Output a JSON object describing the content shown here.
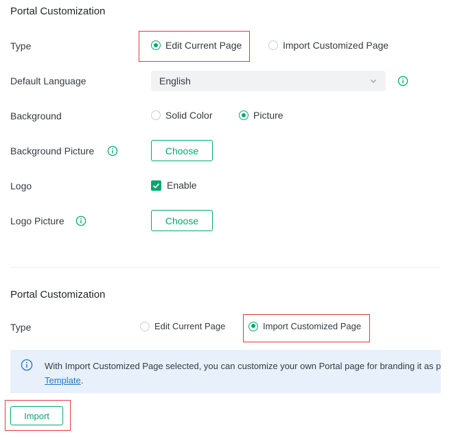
{
  "section1": {
    "title": "Portal Customization",
    "type_label": "Type",
    "type_options": [
      "Edit Current Page",
      "Import Customized Page"
    ],
    "default_language_label": "Default Language",
    "default_language_value": "English",
    "background_label": "Background",
    "background_options": [
      "Solid Color",
      "Picture"
    ],
    "background_picture_label": "Background Picture",
    "choose_label": "Choose",
    "logo_label": "Logo",
    "logo_enable_label": "Enable",
    "logo_picture_label": "Logo Picture",
    "logo_choose_label": "Choose"
  },
  "section2": {
    "title": "Portal Customization",
    "type_label": "Type",
    "type_options": [
      "Edit Current Page",
      "Import Customized Page"
    ],
    "banner_text": "With Import Customized Page selected, you can customize your own Portal page for branding it as pe",
    "banner_link": "Template",
    "banner_link_suffix": ".",
    "import_label": "Import"
  },
  "colors": {
    "accent": "#00a870",
    "highlight": "#e0393e",
    "info": "#1f73c4",
    "banner_bg": "#e8f1fb"
  },
  "icons": {
    "info": "info-circle-icon",
    "dropdown": "chevron-down-icon",
    "check": "check-icon"
  }
}
